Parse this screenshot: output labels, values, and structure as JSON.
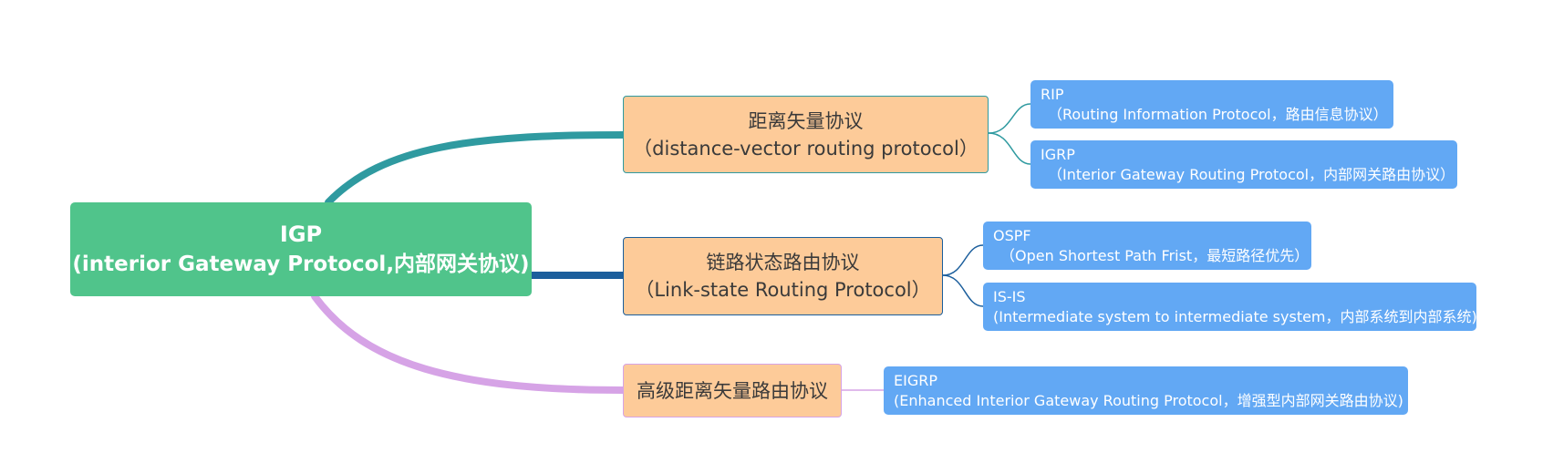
{
  "root": {
    "title": "IGP",
    "subtitle": "(interior Gateway Protocol,内部网关协议)"
  },
  "branches": [
    {
      "key": "dv",
      "label": "距离矢量协议",
      "sublabel": "（distance-vector routing protocol）",
      "color": "#2f9aa0",
      "leaves": [
        {
          "name": "RIP",
          "desc": "（Routing Information Protocol，路由信息协议）"
        },
        {
          "name": "IGRP",
          "desc": "（Interior Gateway Routing Protocol，内部网关路由协议）"
        }
      ]
    },
    {
      "key": "ls",
      "label": "链路状态路由协议",
      "sublabel": "（Link-state Routing Protocol）",
      "color": "#1b5e9c",
      "leaves": [
        {
          "name": "OSPF",
          "desc": "（Open Shortest Path Frist，最短路径优先）"
        },
        {
          "name": "IS-IS",
          "desc": "(Intermediate system to intermediate system，内部系统到内部系统)"
        }
      ]
    },
    {
      "key": "adv",
      "label": "高级距离矢量路由协议",
      "color": "#d6a3e6",
      "leaves": [
        {
          "name": "EIGRP",
          "desc": "(Enhanced Interior Gateway Routing Protocol，增强型内部网关路由协议)"
        }
      ]
    }
  ],
  "colors": {
    "root_fill": "#50c48b",
    "branch_fill": "#fdcb99",
    "leaf_fill": "#62a8f4"
  }
}
